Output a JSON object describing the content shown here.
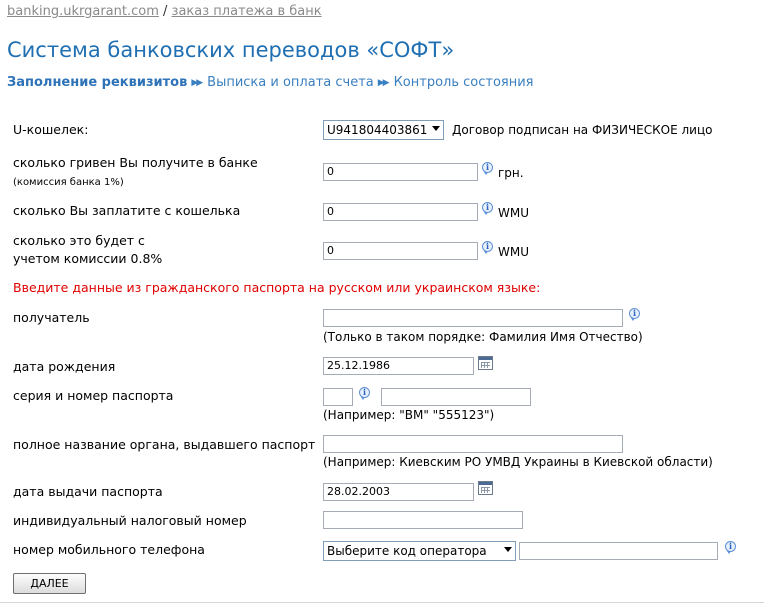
{
  "breadcrumb": {
    "site": "banking.ukrgarant.com",
    "sep": "/",
    "page": "заказ платежа в банк"
  },
  "page_title": "Система банковских переводов «СОФТ»",
  "steps": [
    "Заполнение реквизитов",
    "Выписка и оплата счета",
    "Контроль состояния"
  ],
  "arrow": "▶▶",
  "wallet": {
    "label": "U-кошелек:",
    "value": "U941804403861",
    "contract": "Договор подписан на ФИЗИЧЕСКОЕ лицо"
  },
  "receive": {
    "label": "сколько гривен Вы получите в банке",
    "note": "(комиссия банка 1%)",
    "value": "0",
    "unit": "грн."
  },
  "pay": {
    "label": "сколько Вы заплатите с кошелька",
    "value": "0",
    "unit": "WMU"
  },
  "commission": {
    "label1": "сколько это будет с",
    "label2": "учетом комиссии 0.8%",
    "value": "0",
    "unit": "WMU"
  },
  "warning": "Введите данные из гражданского паспорта на русском или украинском языке:",
  "recipient": {
    "label": "получатель",
    "value": "",
    "hint": "(Только в таком порядке: Фамилия Имя Отчество)"
  },
  "birth": {
    "label": "дата рождения",
    "value": "25.12.1986"
  },
  "passport": {
    "label": "серия и номер паспорта",
    "series": "",
    "number": "",
    "hint": "(Например: \"ВМ\" \"555123\")"
  },
  "issuer": {
    "label": "полное название органа, выдавшего паспорт",
    "value": "",
    "hint": "(Например: Киевским РО УМВД Украины в Киевской области)"
  },
  "issue_date": {
    "label": "дата выдачи паспорта",
    "value": "28.02.2003"
  },
  "tax": {
    "label": "индивидуальный налоговый номер",
    "value": ""
  },
  "phone": {
    "label": "номер мобильного телефона",
    "operator": "Выберите код оператора",
    "value": ""
  },
  "info_glyph": "i",
  "next_button": "ДАЛЕЕ"
}
